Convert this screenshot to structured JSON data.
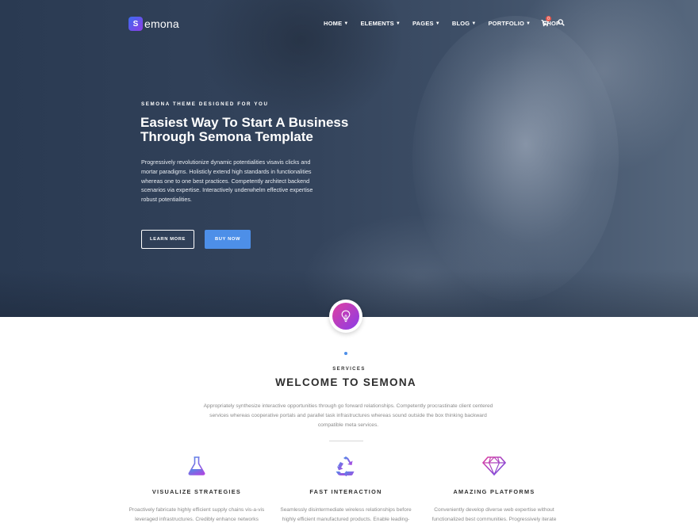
{
  "brand": {
    "logo_letter": "S",
    "name": "emona"
  },
  "nav": {
    "items": [
      {
        "label": "HOME",
        "has_dropdown": true
      },
      {
        "label": "ELEMENTS",
        "has_dropdown": true
      },
      {
        "label": "PAGES",
        "has_dropdown": true
      },
      {
        "label": "BLOG",
        "has_dropdown": true
      },
      {
        "label": "PORTFOLIO",
        "has_dropdown": true
      },
      {
        "label": "SHOP",
        "has_dropdown": false
      }
    ],
    "cart_count": "0",
    "icons": [
      "cart-icon",
      "search-icon"
    ]
  },
  "hero": {
    "eyebrow": "SEMONA THEME DESIGNED FOR YOU",
    "title_line1": "Easiest Way To Start A Business",
    "title_line2": "Through Semona Template",
    "description": "Progressively revolutionize dynamic potentialities visavis clicks and mortar paradigms. Holisticly extend high standards in functionalities whereas one to one best practices. Competently architect backend scenarios via expertise. Interactively underwhelm effective expertise robust potentialities.",
    "btn_learn": "LEARN MORE",
    "btn_buy": "BUY NOW"
  },
  "services": {
    "eyebrow": "SERVICES",
    "title": "WELCOME TO SEMONA",
    "description": "Appropriately synthesize interactive opportunities through go forward relationships. Competently procrastinate client centered services whereas cooperative portals and parallel task infrastructures whereas sound outside the box thinking backward compatible meta services.",
    "features": [
      {
        "icon": "flask-icon",
        "title": "VISUALIZE STRATEGIES",
        "description": "Proactively fabricate highly efficient supply chains vis-a-vis leveraged infrastructures. Credibly enhance networks"
      },
      {
        "icon": "recycle-icon",
        "title": "FAST INTERACTION",
        "description": "Seamlessly disintermediate wireless relationships before highly efficient manufactured products. Enable leading-"
      },
      {
        "icon": "diamond-icon",
        "title": "AMAZING PLATFORMS",
        "description": "Conveniently develop diverse web expertise without functionalized best communities. Progressively iterate"
      }
    ]
  },
  "colors": {
    "accent_blue": "#4d8fe8",
    "gradient_start": "#e040a0",
    "gradient_end": "#8a3ce8"
  }
}
